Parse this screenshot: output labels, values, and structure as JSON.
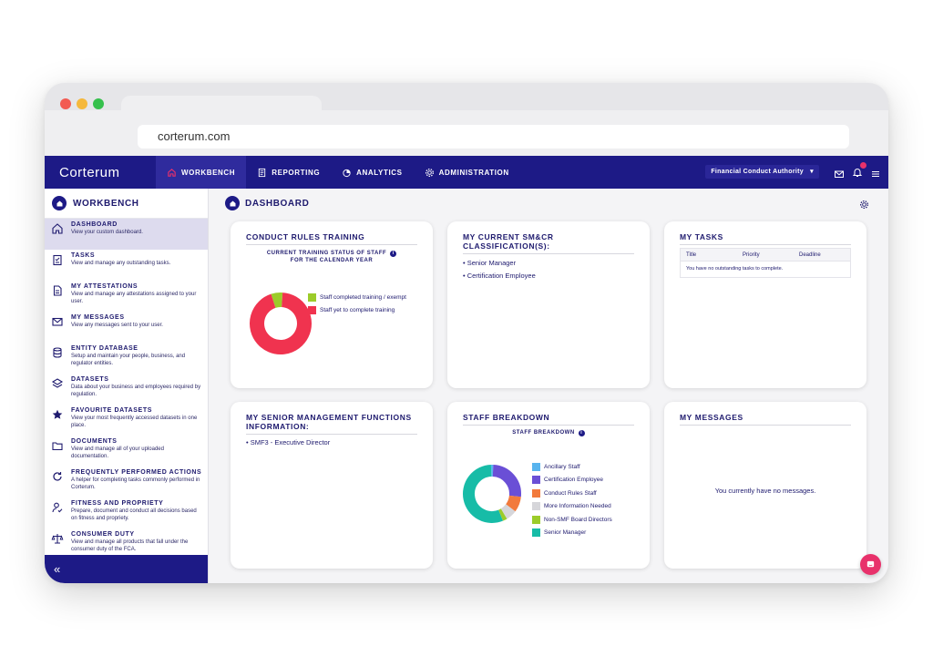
{
  "browser": {
    "url": "corterum.com"
  },
  "topnav": {
    "brand": "Corterum",
    "items": [
      {
        "label": "WORKBENCH",
        "icon": "home-icon",
        "active": true
      },
      {
        "label": "REPORTING",
        "icon": "report-icon",
        "active": false
      },
      {
        "label": "ANALYTICS",
        "icon": "analytics-icon",
        "active": false
      },
      {
        "label": "ADMINISTRATION",
        "icon": "gear-icon",
        "active": false
      }
    ],
    "organisation": "Financial Conduct Authority",
    "organisation_caret": "▾"
  },
  "sidebar": {
    "title": "WORKBENCH",
    "collapse_glyph": "«",
    "items": [
      {
        "title": "DASHBOARD",
        "desc": "View your custom dashboard.",
        "icon": "home-icon"
      },
      {
        "title": "TASKS",
        "desc": "View and manage any outstanding tasks.",
        "icon": "clipboard-icon"
      },
      {
        "title": "MY ATTESTATIONS",
        "desc": "View and manage any attestations assigned to your user.",
        "icon": "document-icon"
      },
      {
        "title": "MY MESSAGES",
        "desc": "View any messages sent to your user.",
        "icon": "envelope-icon"
      },
      {
        "title": "ENTITY DATABASE",
        "desc": "Setup and maintain your people, business, and regulator entities.",
        "icon": "database-icon"
      },
      {
        "title": "DATASETS",
        "desc": "Data about your business and employees required by regulation.",
        "icon": "layers-icon"
      },
      {
        "title": "FAVOURITE DATASETS",
        "desc": "View your most frequently accessed datasets in one place.",
        "icon": "star-icon"
      },
      {
        "title": "DOCUMENTS",
        "desc": "View and manage all of your uploaded documentation.",
        "icon": "folder-icon"
      },
      {
        "title": "FREQUENTLY PERFORMED ACTIONS",
        "desc": "A helper for completing tasks commonly performed in Corterum.",
        "icon": "refresh-icon"
      },
      {
        "title": "FITNESS AND PROPRIETY",
        "desc": "Prepare, document and conduct all decisions based on fitness and propriety.",
        "icon": "person-check-icon"
      },
      {
        "title": "CONSUMER DUTY",
        "desc": "View and manage all products that fall under the consumer duty of the FCA.",
        "icon": "scales-icon"
      }
    ]
  },
  "dashboard": {
    "title": "DASHBOARD",
    "conduct": {
      "title": "CONDUCT RULES TRAINING",
      "subtitle_line1": "CURRENT TRAINING STATUS OF STAFF",
      "subtitle_line2": "FOR THE CALENDAR YEAR",
      "info": "i"
    },
    "smcr": {
      "title_line1": "MY CURRENT SM&CR",
      "title_line2": "CLASSIFICATION(S):",
      "items": [
        "• Senior Manager",
        "• Certification Employee"
      ]
    },
    "tasks": {
      "title": "MY TASKS",
      "columns": [
        "Title",
        "Priority",
        "Deadline"
      ],
      "empty": "You have no outstanding tasks to complete."
    },
    "smf": {
      "title_line1": "MY SENIOR MANAGEMENT FUNCTIONS",
      "title_line2": "INFORMATION:",
      "items": [
        "• SMF3 - Executive Director"
      ]
    },
    "staff": {
      "title": "STAFF BREAKDOWN",
      "subtitle": "STAFF BREAKDOWN",
      "info": "i"
    },
    "messages": {
      "title": "MY MESSAGES",
      "empty": "You currently have no messages."
    }
  },
  "chart_data": [
    {
      "type": "pie",
      "variant": "donut",
      "categories": [
        "Staff completed training / exempt",
        "Staff yet to complete training"
      ],
      "values": [
        6,
        94
      ],
      "colors": [
        "#9ccc2a",
        "#f0334f"
      ],
      "legend": "right"
    },
    {
      "type": "pie",
      "variant": "donut",
      "categories": [
        "Ancillary Staff",
        "Certification Employee",
        "Conduct Rules Staff",
        "More Information Needed",
        "Non-SMF Board Directors",
        "Senior Manager"
      ],
      "values": [
        1,
        21,
        7,
        5,
        2,
        45
      ],
      "colors": [
        "#58b4ee",
        "#6a4fd6",
        "#f27a3c",
        "#d6d6da",
        "#9ccc2a",
        "#17bca7"
      ],
      "legend": "right"
    }
  ]
}
